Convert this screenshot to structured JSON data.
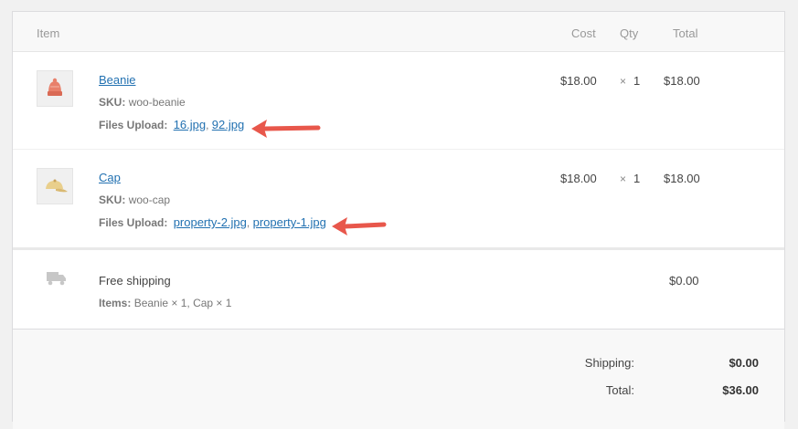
{
  "columns": {
    "item": "Item",
    "cost": "Cost",
    "qty": "Qty",
    "total": "Total"
  },
  "line_items": [
    {
      "name": "Beanie",
      "sku_label": "SKU:",
      "sku": "woo-beanie",
      "files_label": "Files Upload:",
      "files": [
        "16.jpg",
        "92.jpg"
      ],
      "cost": "$18.00",
      "qty_prefix": "×",
      "qty": "1",
      "total": "$18.00"
    },
    {
      "name": "Cap",
      "sku_label": "SKU:",
      "sku": "woo-cap",
      "files_label": "Files Upload:",
      "files": [
        "property-2.jpg",
        "property-1.jpg"
      ],
      "cost": "$18.00",
      "qty_prefix": "×",
      "qty": "1",
      "total": "$18.00"
    }
  ],
  "shipping_line": {
    "method": "Free shipping",
    "items_label": "Items:",
    "items_value": "Beanie × 1, Cap × 1",
    "total": "$0.00"
  },
  "totals": {
    "shipping_label": "Shipping:",
    "shipping_value": "$0.00",
    "total_label": "Total:",
    "total_value": "$36.00"
  },
  "separators": {
    "comma": ","
  },
  "colors": {
    "link": "#2271b1",
    "arrow": "#e8574b"
  }
}
